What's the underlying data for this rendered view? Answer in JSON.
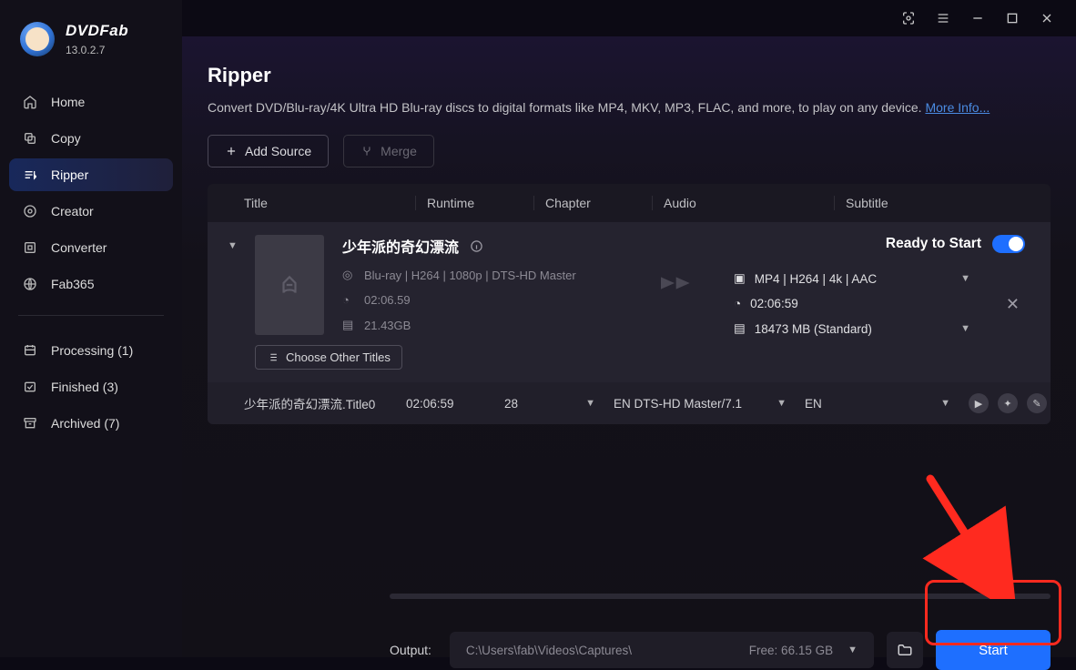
{
  "brand": {
    "name": "DVDFab",
    "version": "13.0.2.7"
  },
  "window_controls": {
    "theme": "theme",
    "menu": "menu",
    "min": "minimize",
    "max": "maximize",
    "close": "close"
  },
  "sidebar": {
    "items": [
      {
        "label": "Home"
      },
      {
        "label": "Copy"
      },
      {
        "label": "Ripper"
      },
      {
        "label": "Creator"
      },
      {
        "label": "Converter"
      },
      {
        "label": "Fab365"
      }
    ],
    "tasks": [
      {
        "label": "Processing (1)"
      },
      {
        "label": "Finished (3)"
      },
      {
        "label": "Archived (7)"
      }
    ]
  },
  "page": {
    "title": "Ripper",
    "description": "Convert DVD/Blu-ray/4K Ultra HD Blu-ray discs to digital formats like MP4, MKV, MP3, FLAC, and more, to play on any device. ",
    "more_info": "More Info...",
    "toolbar": {
      "add_source": "Add Source",
      "merge": "Merge"
    }
  },
  "list": {
    "headers": {
      "title": "Title",
      "runtime": "Runtime",
      "chapter": "Chapter",
      "audio": "Audio",
      "subtitle": "Subtitle"
    },
    "item": {
      "title": "少年派的奇幻漂流",
      "ready": "Ready to Start",
      "source": {
        "spec": "Blu-ray | H264 | 1080p | DTS-HD Master",
        "runtime": "02:06.59",
        "size": "21.43GB"
      },
      "output": {
        "spec": "MP4 | H264 | 4k | AAC",
        "runtime": "02:06:59",
        "size": "18473 MB (Standard)"
      },
      "choose_other": "Choose Other Titles"
    },
    "subrow": {
      "title": "少年派的奇幻漂流.Title0",
      "runtime": "02:06:59",
      "chapter": "28",
      "audio": "EN  DTS-HD Master/7.1",
      "subtitle": "EN"
    }
  },
  "footer": {
    "label": "Output:",
    "path": "C:\\Users\\fab\\Videos\\Captures\\",
    "free": "Free: 66.15 GB",
    "start": "Start"
  }
}
